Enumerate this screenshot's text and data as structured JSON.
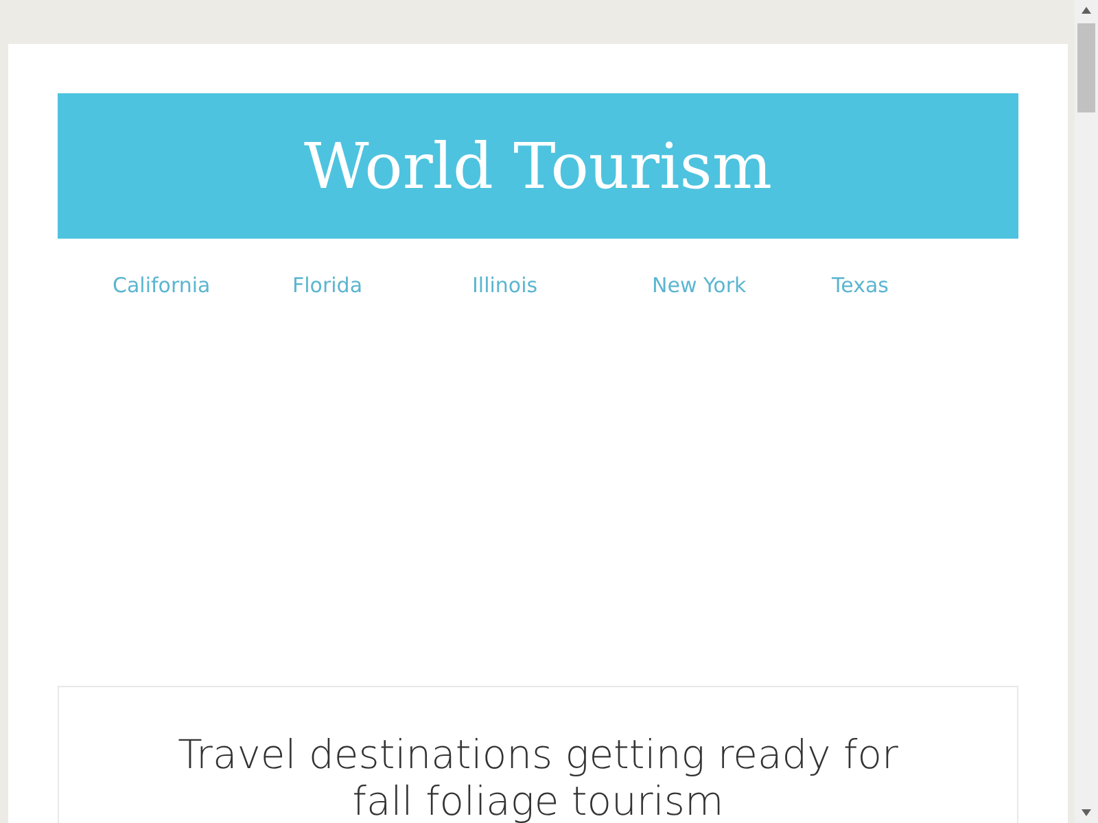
{
  "site_title": "World Tourism",
  "nav": [
    {
      "label": "California"
    },
    {
      "label": "Florida"
    },
    {
      "label": "Illinois"
    },
    {
      "label": "New York"
    },
    {
      "label": "Texas"
    }
  ],
  "article": {
    "title": "Travel destinations getting ready for fall foliage tourism"
  }
}
